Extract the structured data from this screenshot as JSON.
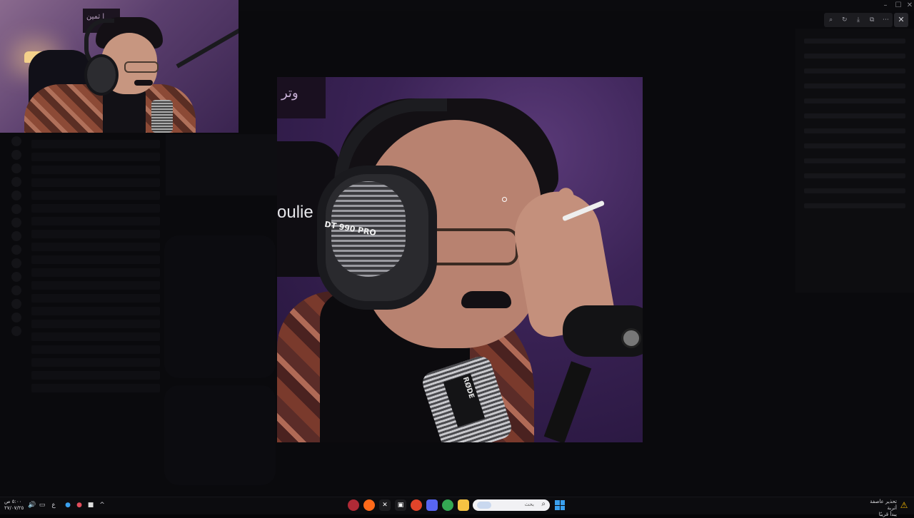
{
  "window": {
    "title": "",
    "controls": {
      "minimize": "–",
      "maximize": "☐",
      "close": "✕"
    }
  },
  "viewer": {
    "toolbar_icons": [
      "zoom-in-icon",
      "rotate-icon",
      "download-icon",
      "open-external-icon",
      "more-icon"
    ],
    "toolbar_glyphs": {
      "zoom": "⌕",
      "rotate": "↻",
      "download": "⤓",
      "open": "⧉",
      "more": "⋯"
    },
    "close_glyph": "✕"
  },
  "webcam": {
    "sign_text": "ا ثمين"
  },
  "photo": {
    "sign_text": "وتر",
    "logo_text": "oulie",
    "headphone_label": "DT 990 PRO",
    "mic_label": "RØDE"
  },
  "taskbar": {
    "clock_time": "٥:٠٠ ص",
    "clock_date": "٢٧/٠٧/٢٥",
    "language": "ع",
    "search_placeholder": "بحث",
    "search_glyph": "⌕",
    "weather_title": "تحذير عاصفة أتربة",
    "weather_subtitle": "يبدأ قريبًا",
    "weather_glyph": "⚠",
    "tray_glyphs": {
      "notify": "▭",
      "volume": "🔊",
      "chevron": "^"
    },
    "apps": [
      "discord-like-app-icon",
      "firefox-icon",
      "capcut-icon",
      "terminal-icon",
      "discord-icon",
      "chrome-icon",
      "file-explorer-icon"
    ],
    "colors": {
      "accent": "#3aa0ee",
      "warning": "#f0b400"
    }
  }
}
